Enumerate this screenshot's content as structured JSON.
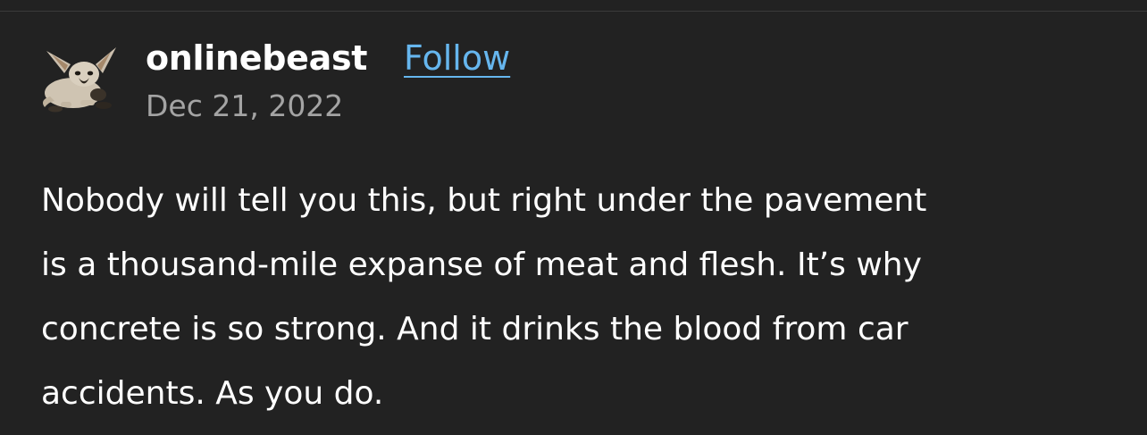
{
  "post": {
    "author": "onlinebeast",
    "follow_label": "Follow",
    "date": "Dec 21, 2022",
    "text": "Nobody will tell you this, but right under the pavement\nis a thousand-mile expanse of meat and flesh. It’s why\nconcrete is so strong.  And it drinks the blood from car\naccidents. As you do."
  },
  "colors": {
    "background": "#222222",
    "link": "#66b6ee",
    "date": "#a4a4a4",
    "text": "#ffffff"
  }
}
